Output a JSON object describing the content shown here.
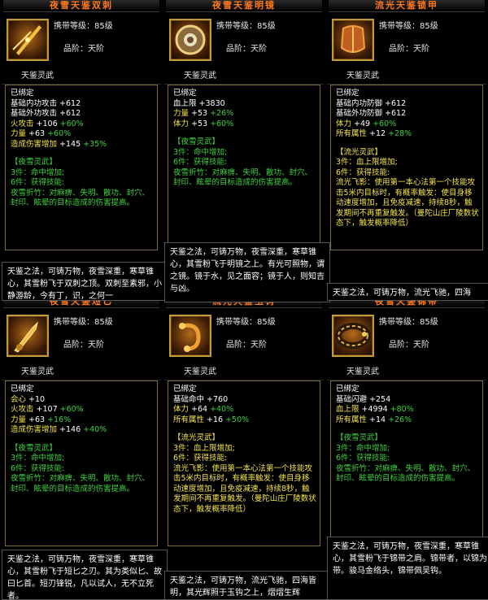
{
  "panels": [
    {
      "title": "夜雪天鉴双刺",
      "level": "携带等级：85级",
      "grade": "品阶：天阶",
      "category": "天鉴灵武",
      "bound": "已绑定",
      "stats": [
        {
          "label": "基础内功攻击 ",
          "value": "+612",
          "pct": "",
          "lc": "w"
        },
        {
          "label": "基础外功攻击 ",
          "value": "+612",
          "pct": "",
          "lc": "w"
        },
        {
          "label": "火攻击 ",
          "value": "+106",
          "pct": "+60%",
          "lc": "y"
        },
        {
          "label": "力量 ",
          "value": "+63",
          "pct": "+60%",
          "lc": "y"
        },
        {
          "label": "造成伤害增加 ",
          "value": "+145",
          "pct": "+35%",
          "lc": "y"
        }
      ],
      "set_name": "【夜雪灵武】",
      "set_lines": [
        "3件：命中增加;",
        "6件：获得技能:",
        "夜雪折竹：对麻痹、失明、散功、封穴、封印、眩晕的目标造成的伤害提高。"
      ],
      "set_color": "g",
      "desc": "天鉴之法，可铸万物，夜雪深重，寒草锥心，其雪粉飞于双刺之顶。双刺至素邪，小静游龄，今有丁，识，之何一"
    },
    {
      "title": "夜雪天鉴明镜",
      "level": "携带等级：85级",
      "grade": "品阶：天阶",
      "category": "天鉴灵武",
      "bound": "已绑定",
      "stats": [
        {
          "label": "血上限 ",
          "value": "+3830",
          "pct": "",
          "lc": "w"
        },
        {
          "label": "力量 ",
          "value": "+53",
          "pct": "+26%",
          "lc": "y"
        },
        {
          "label": "体力 ",
          "value": "+53",
          "pct": "+60%",
          "lc": "y"
        }
      ],
      "set_name": "【夜雪灵武】",
      "set_lines": [
        "3件：命中增加;",
        "6件：获得技能:",
        "夜雪折竹：对麻痹、失明、散功、封穴、封印、眩晕的目标造成的伤害提高。"
      ],
      "set_color": "g",
      "desc": "天鉴之法，可铸万物，夜雪深重，寒草锥心，其雪粉飞于明镜之上。有光可照物，谓之镜。镜于水，见之面容；镜于人，则知吉与凶。"
    },
    {
      "title": "流光天鉴锁甲",
      "level": "携带等级：85级",
      "grade": "品阶：天阶",
      "category": "天鉴灵武",
      "bound": "已绑定",
      "stats": [
        {
          "label": "基础内功防御 ",
          "value": "+612",
          "pct": "",
          "lc": "w"
        },
        {
          "label": "基础外功防御 ",
          "value": "+612",
          "pct": "",
          "lc": "w"
        },
        {
          "label": "体力 ",
          "value": "+49",
          "pct": "+60%",
          "lc": "y"
        },
        {
          "label": "所有属性 ",
          "value": "+12",
          "pct": "+28%",
          "lc": "y"
        }
      ],
      "set_name": "【流光灵武】",
      "set_lines": [
        "3件：血上限增加;",
        "6件：获得技能:",
        "流光飞影：使用第一本心法第一个技能攻击5米内目标时，有概率触发：使目身移动速度增加，且免疫减速，持续8秒，触发期间不再重复触发。（曼陀山庄厂陵数状态下，触发概率降低）"
      ],
      "set_color": "y",
      "desc": "天鉴之法，可铸万物，流光飞驰，四海"
    },
    {
      "title": "夜雪天鉴短匕",
      "level": "携带等级：85级",
      "grade": "品阶：天阶",
      "category": "天鉴灵武",
      "bound": "已绑定",
      "stats": [
        {
          "label": "会心 ",
          "value": "+10",
          "pct": "",
          "lc": "y"
        },
        {
          "label": "火攻击 ",
          "value": "+107",
          "pct": "+60%",
          "lc": "y"
        },
        {
          "label": "力量 ",
          "value": "+63",
          "pct": "+16%",
          "lc": "y"
        },
        {
          "label": "造成伤害增加 ",
          "value": "+146",
          "pct": "+40%",
          "lc": "y"
        }
      ],
      "set_name": "【夜雪灵武】",
      "set_lines": [
        "3件：命中增加;",
        "6件：获得技能:",
        "夜雪折竹：对麻痹、失明、散功、封穴、封印、眩晕的目标造成的伤害提高。"
      ],
      "set_color": "g",
      "desc": "天鉴之法，可铸万物，夜雪深重，寒草锥心，其雪粉飞于短匕之刃。其为类似匕、故曰匕首。短刃锋锐，凡以试人，无不立死者。"
    },
    {
      "title": "流光天鉴玉钩",
      "level": "携带等级：85级",
      "grade": "品阶：天阶",
      "category": "天鉴灵武",
      "bound": "已绑定",
      "stats": [
        {
          "label": "基础命中 ",
          "value": "+760",
          "pct": "",
          "lc": "w"
        },
        {
          "label": "体力 ",
          "value": "+64",
          "pct": "+40%",
          "lc": "y"
        },
        {
          "label": "所有属性 ",
          "value": "+16",
          "pct": "+50%",
          "lc": "y"
        }
      ],
      "set_name": "【流光灵武】",
      "set_lines": [
        "3件：血上限增加;",
        "6件：获得技能:",
        "流光飞影：使用第一本心法第一个技能攻击5米内目标时，有概率触发：使目身移动速度增加，且免疫减速，持续8秒，触发期间不再重复触发。（曼陀山庄厂陵数状态下，触发概率降低）"
      ],
      "set_color": "y",
      "desc": "天鉴之法，可铸万物，流光飞驰，四海皆明，其光辉照于玉钩之上，熠熠生辉"
    },
    {
      "title": "夜雪天鉴锦带",
      "level": "携带等级：85级",
      "grade": "品阶：天阶",
      "category": "天鉴灵武",
      "bound": "已绑定",
      "stats": [
        {
          "label": "基础闪避 ",
          "value": "+254",
          "pct": "",
          "lc": "w"
        },
        {
          "label": "血上限 ",
          "value": "+4994",
          "pct": "+80%",
          "lc": "y"
        },
        {
          "label": "所有属性 ",
          "value": "+14",
          "pct": "+26%",
          "lc": "y"
        }
      ],
      "set_name": "【夜雪灵武】",
      "set_lines": [
        "3件：命中增加;",
        "6件：获得技能:",
        "夜雪折竹：对麻痹、失明、散功、封穴、封印、眩晕的目标造成的伤害提高。"
      ],
      "set_color": "g",
      "desc": "天鉴之法，可铸万物，夜雪深重，寒草锥心，其雪粉飞于锦带之肩。锦带者，以锦为带。骏马金络头，锦带佩吴钩。"
    }
  ]
}
